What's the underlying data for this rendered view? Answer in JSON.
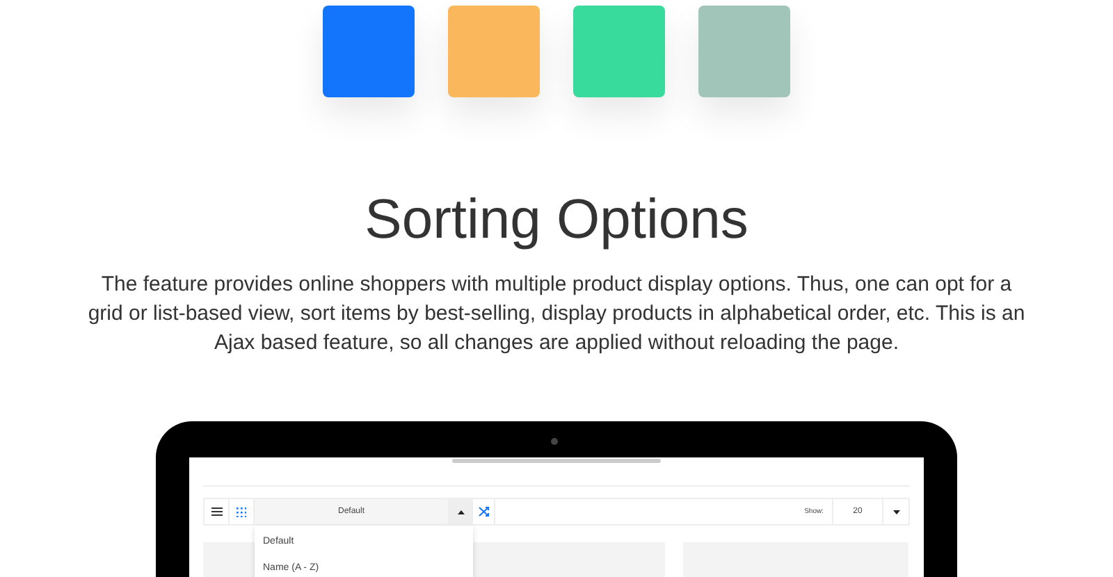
{
  "swatches": [
    {
      "color": "#1375fb"
    },
    {
      "color": "#fab75c"
    },
    {
      "color": "#38db9b"
    },
    {
      "color": "#a1c5b9"
    }
  ],
  "heading": "Sorting Options",
  "description": "The feature provides online shoppers with multiple product display options. Thus, one can opt for a grid or list-based view, sort items by best-selling, display products in alphabetical order, etc. This is an Ajax based feature, so all changes are applied without reloading the page.",
  "laptop": {
    "toolbar": {
      "views": [
        {
          "kind": "list",
          "selected": false
        },
        {
          "kind": "grid",
          "selected": true
        }
      ],
      "sort": {
        "value": "Default",
        "expanded": true,
        "options": [
          "Default",
          "Name (A - Z)"
        ]
      },
      "show_label": "Show:",
      "show_value": "20"
    }
  }
}
